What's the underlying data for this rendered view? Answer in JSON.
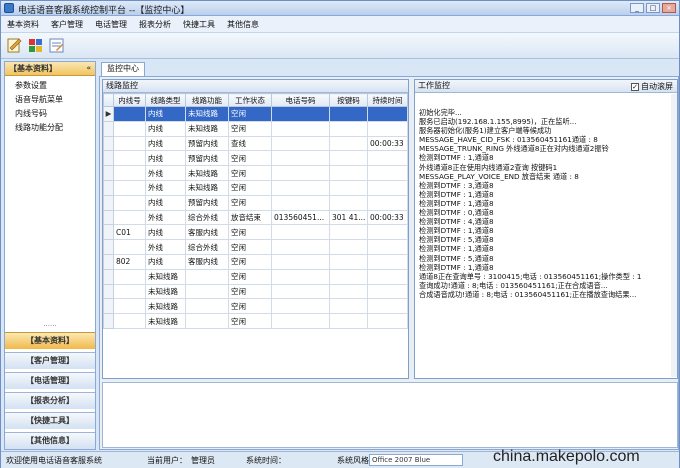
{
  "window": {
    "title": "电话语音客服系统控制平台 --【监控中心】"
  },
  "menu": [
    "基本资料",
    "客户管理",
    "电话管理",
    "报表分析",
    "快捷工具",
    "其他信息"
  ],
  "toolbar": {
    "icons": [
      "edit-icon",
      "chart-icon",
      "notes-icon"
    ]
  },
  "sidebar": {
    "header": "【基本资料】",
    "items": [
      "参数设置",
      "语音导航菜单",
      "内线号码",
      "线路功能分配"
    ],
    "dots": "......",
    "groups": [
      "【基本资料】",
      "【客户管理】",
      "【电话管理】",
      "【报表分析】",
      "【快捷工具】",
      "【其他信息】"
    ]
  },
  "tab": {
    "label": "监控中心"
  },
  "line_panel": {
    "title": "线路监控",
    "columns": [
      "内线号",
      "线路类型",
      "线路功能",
      "工作状态",
      "电话号码",
      "按键码",
      "持续时间"
    ],
    "rows": [
      [
        "",
        "内线",
        "未知线路",
        "空闲",
        "",
        "",
        ""
      ],
      [
        "",
        "内线",
        "未知线路",
        "空闲",
        "",
        "",
        ""
      ],
      [
        "",
        "内线",
        "预留内线",
        "查线",
        "",
        "",
        "00:00:33"
      ],
      [
        "",
        "内线",
        "预留内线",
        "空闲",
        "",
        "",
        ""
      ],
      [
        "",
        "外线",
        "未知线路",
        "空闲",
        "",
        "",
        ""
      ],
      [
        "",
        "外线",
        "未知线路",
        "空闲",
        "",
        "",
        ""
      ],
      [
        "",
        "内线",
        "预留内线",
        "空闲",
        "",
        "",
        ""
      ],
      [
        "",
        "外线",
        "综合外线",
        "放音结束",
        "013560451...",
        "301 41...",
        "00:00:33"
      ],
      [
        "C01",
        "内线",
        "客服内线",
        "空闲",
        "",
        "",
        ""
      ],
      [
        "",
        "外线",
        "综合外线",
        "空闲",
        "",
        "",
        ""
      ],
      [
        "802",
        "内线",
        "客服内线",
        "空闲",
        "",
        "",
        ""
      ],
      [
        "",
        "未知线路",
        "",
        "空闲",
        "",
        "",
        ""
      ],
      [
        "",
        "未知线路",
        "",
        "空闲",
        "",
        "",
        ""
      ],
      [
        "",
        "未知线路",
        "",
        "空闲",
        "",
        "",
        ""
      ],
      [
        "",
        "未知线路",
        "",
        "空闲",
        "",
        "",
        ""
      ]
    ]
  },
  "work_panel": {
    "title": "工作监控",
    "auto_scroll_label": "自动滚屏",
    "auto_scroll_checked": "✓",
    "log": [
      "初始化完毕...",
      "服务已启动(192.168.1.155,8995)，正在监听...",
      "服务器初始化(服务1)建立客户端等候成功",
      "MESSAGE_HAVE_CID_FSK : 013560451161通道 : 8",
      "MESSAGE_TRUNK_RING 外线通道8正在对内线通道2振铃",
      "检测到DTMF : 1,通道8",
      "外线通道8正在使用内线通道2查询 按键码1",
      "MESSAGE_PLAY_VOICE_END 放音结束 通道 : 8",
      "检测到DTMF : 3,通道8",
      "检测到DTMF : 1,通道8",
      "检测到DTMF : 1,通道8",
      "检测到DTMF : 0,通道8",
      "检测到DTMF : 4,通道8",
      "检测到DTMF : 1,通道8",
      "检测到DTMF : 5,通道8",
      "检测到DTMF : 1,通道8",
      "检测到DTMF : 5,通道8",
      "检测到DTMF : 1,通道8",
      "通道8正在查询单号 : 3100415;电话 : 013560451161;操作类型 : 1",
      "查询成功!通道 : 8;电话 : 013560451161;正在合成语音...",
      "合成语音成功!通道 : 8;电话 : 013560451161;正在播放查询结果..."
    ]
  },
  "statusbar": {
    "company": "欢迎使用电话语音客服系统",
    "user_label": "当前用户：",
    "user_value": "管理员",
    "time_label": "系统时间：",
    "style_label": "系统风格：",
    "style_value": "Office 2007 Blue"
  },
  "watermark": "china.makepolo.com",
  "colors": {
    "selection": "#3468c7",
    "active_group": "#f2b84a",
    "panel_border": "#8aa8d6"
  }
}
